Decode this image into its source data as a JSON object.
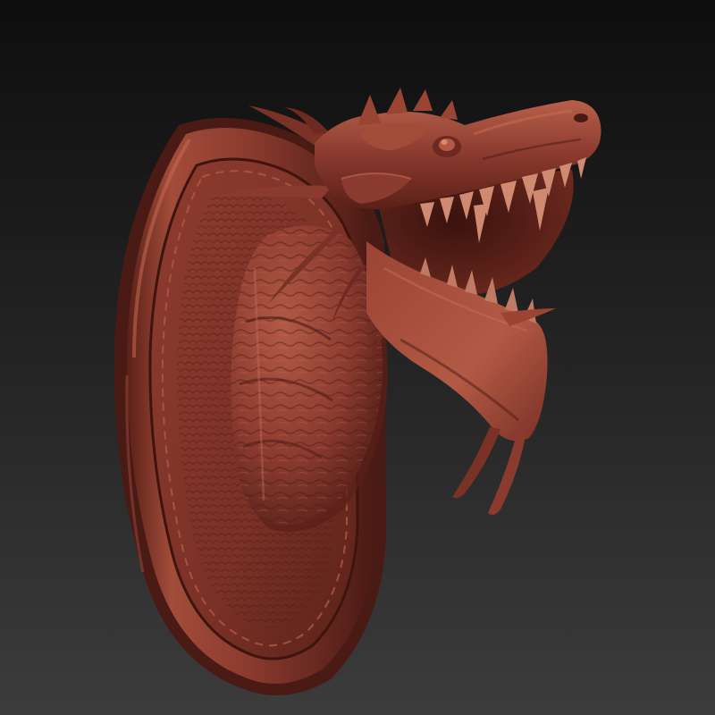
{
  "scene": {
    "subject": "mounted-dragon-head-sculpt",
    "colors": {
      "background_top": "#0e0e0e",
      "background_bottom": "#3c3c3c",
      "clay_base": "#8a3a2e",
      "clay_light": "#b35a46",
      "clay_dark": "#4a1a14",
      "clay_mid": "#6e2a20"
    }
  }
}
